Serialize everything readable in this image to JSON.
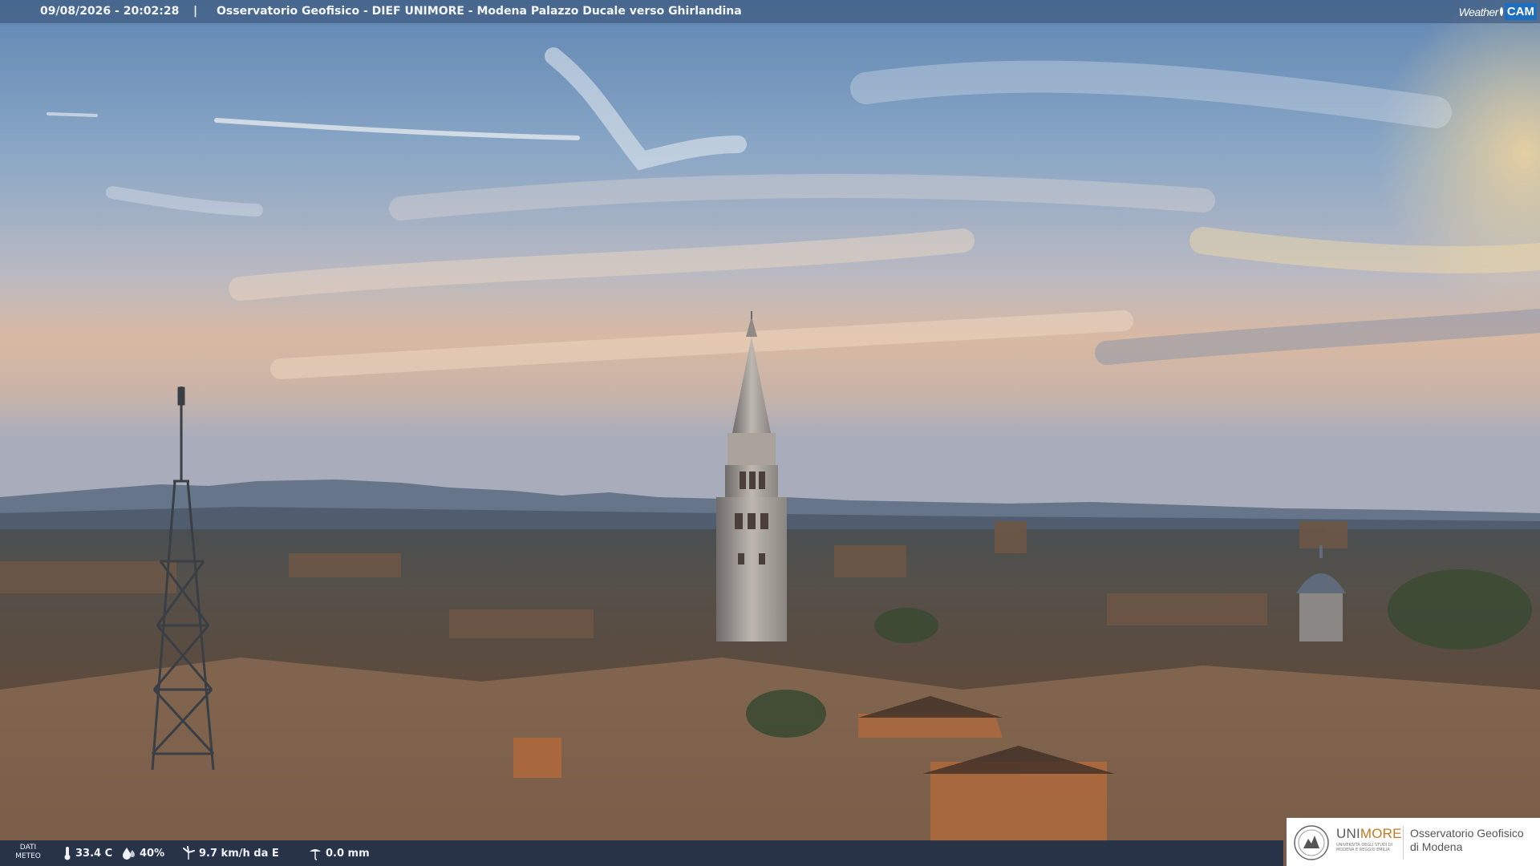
{
  "header": {
    "timestamp": "09/08/2026 - 20:02:28",
    "separator": "|",
    "location": "Osservatorio Geofisico - DIEF UNIMORE - Modena Palazzo Ducale verso Ghirlandina"
  },
  "brand": {
    "weather_text": "Weather",
    "cam_text": "CAM",
    "accent": "#1e8be0"
  },
  "weather": {
    "dati_line1": "DATI",
    "dati_line2": "METEO",
    "temperature": "33.4 C",
    "humidity": "40%",
    "wind": "9.7 km/h da E",
    "rain": "0.0 mm",
    "icons": [
      "thermometer-icon",
      "humidity-drop-icon",
      "wind-turbine-icon",
      "rain-gauge-icon"
    ]
  },
  "logo": {
    "uni_part1": "UNI",
    "uni_part2": "MORE",
    "uni_sub": "UNIVERSITÀ DEGLI STUDI DI MODENA E REGGIO EMILIA",
    "obs_line1": "Osservatorio Geofisico",
    "obs_line2": "di Modena",
    "colors": {
      "gray": "#5a5a5a",
      "orange": "#c8771f"
    }
  },
  "scene": {
    "description_colors": {
      "sky_top": "#5f86b3",
      "sky_horizon": "#d9b79c",
      "mountains": "#5a6b80",
      "roofs": "#5e4535"
    }
  }
}
